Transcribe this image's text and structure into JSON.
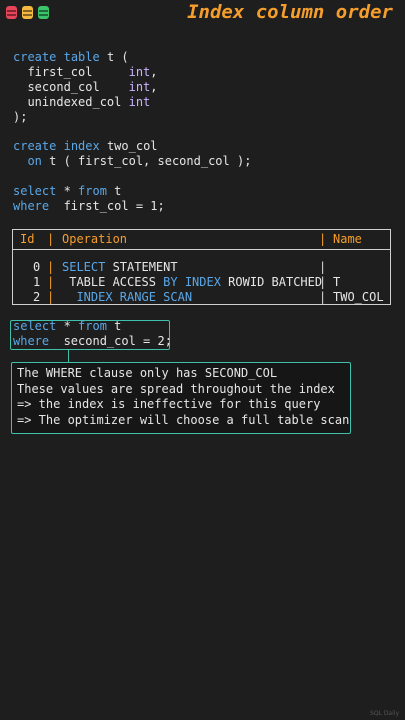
{
  "header": {
    "title": "Index column order",
    "dot_colors": [
      "#e8455a",
      "#f5b942",
      "#3cc46a"
    ]
  },
  "code": {
    "create_table": [
      [
        {
          "t": "create",
          "c": "kw"
        },
        {
          "t": " "
        },
        {
          "t": "table",
          "c": "kw"
        },
        {
          "t": " t ("
        }
      ],
      [
        {
          "t": "  first_col     "
        },
        {
          "t": "int",
          "c": "ty"
        },
        {
          "t": ","
        }
      ],
      [
        {
          "t": "  second_col    "
        },
        {
          "t": "int",
          "c": "ty"
        },
        {
          "t": ","
        }
      ],
      [
        {
          "t": "  unindexed_col "
        },
        {
          "t": "int",
          "c": "ty"
        }
      ],
      [
        {
          "t": ");"
        }
      ]
    ],
    "create_index": [
      [
        {
          "t": "create",
          "c": "kw"
        },
        {
          "t": " "
        },
        {
          "t": "index",
          "c": "kw"
        },
        {
          "t": " two_col"
        }
      ],
      [
        {
          "t": "  "
        },
        {
          "t": "on",
          "c": "kw"
        },
        {
          "t": " t ( first_col, second_col );"
        }
      ]
    ],
    "query1": [
      [
        {
          "t": "select",
          "c": "kw"
        },
        {
          "t": " * "
        },
        {
          "t": "from",
          "c": "kw"
        },
        {
          "t": " t"
        }
      ],
      [
        {
          "t": "where",
          "c": "kw"
        },
        {
          "t": "  first_col = 1;"
        }
      ]
    ],
    "query2": [
      [
        {
          "t": "select",
          "c": "kw"
        },
        {
          "t": " * "
        },
        {
          "t": "from",
          "c": "kw"
        },
        {
          "t": " t"
        }
      ],
      [
        {
          "t": "where",
          "c": "kw"
        },
        {
          "t": "  second_col = 2;"
        }
      ]
    ]
  },
  "plan": {
    "headers": {
      "id": "Id",
      "operation": "Operation",
      "name": "Name"
    },
    "rows": [
      {
        "id": "0",
        "operation": [
          {
            "t": "SELECT",
            "c": "kw"
          },
          {
            "t": " STATEMENT"
          }
        ],
        "name": ""
      },
      {
        "id": "1",
        "operation": [
          {
            "t": " TABLE ACCESS "
          },
          {
            "t": "BY INDEX",
            "c": "kw"
          },
          {
            "t": " ROWID BATCHED"
          }
        ],
        "name": "T"
      },
      {
        "id": "2",
        "operation": [
          {
            "t": "  INDEX RANGE SCAN",
            "c": "kw"
          }
        ],
        "name": "TWO_COL"
      }
    ]
  },
  "note": {
    "lines": [
      "The WHERE clause only has SECOND_COL",
      "These values are spread throughout the index",
      "=> the index is ineffective for this query",
      "=> The optimizer will choose a full table scan"
    ]
  },
  "watermark": "SQL Daily"
}
